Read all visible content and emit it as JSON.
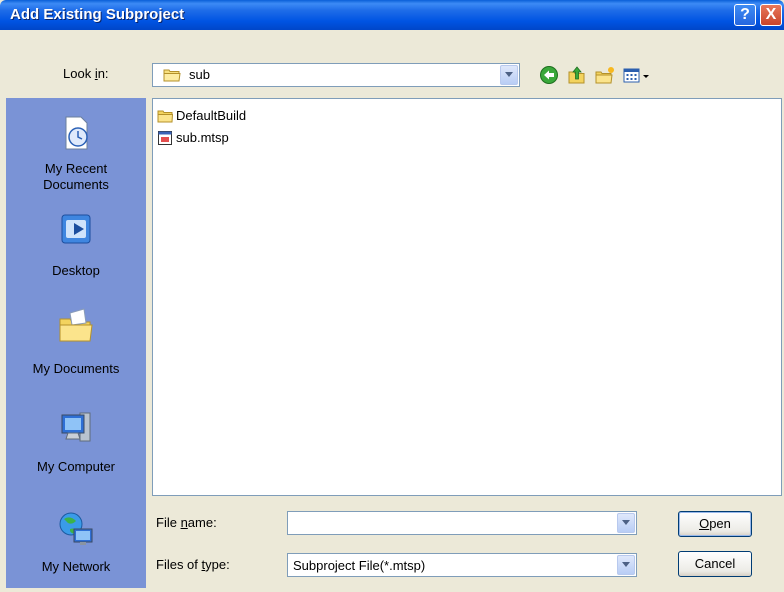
{
  "window": {
    "title": "Add Existing Subproject",
    "help_glyph": "?",
    "close_glyph": "X"
  },
  "lookin": {
    "label_pre": "Look ",
    "label_key": "i",
    "label_post": "n:",
    "value": "sub"
  },
  "toolbar": {
    "icons": [
      "back-icon",
      "up-folder-icon",
      "new-folder-icon",
      "view-menu-icon"
    ]
  },
  "places": [
    {
      "label_line1": "My Recent",
      "label_line2": "Documents",
      "icon": "recent-documents-icon"
    },
    {
      "label_line1": "Desktop",
      "label_line2": "",
      "icon": "desktop-icon"
    },
    {
      "label_line1": "My Documents",
      "label_line2": "",
      "icon": "my-documents-icon"
    },
    {
      "label_line1": "My Computer",
      "label_line2": "",
      "icon": "my-computer-icon"
    },
    {
      "label_line1": "My Network",
      "label_line2": "",
      "icon": "my-network-icon"
    }
  ],
  "files": [
    {
      "name": "DefaultBuild",
      "icon": "folder-icon"
    },
    {
      "name": "sub.mtsp",
      "icon": "mtsp-file-icon"
    }
  ],
  "filename": {
    "label_pre": "File ",
    "label_key": "n",
    "label_post": "ame:",
    "value": ""
  },
  "filetype": {
    "label_pre": "Files of ",
    "label_key": "t",
    "label_post": "ype:",
    "value": "Subproject File(*.mtsp)"
  },
  "buttons": {
    "open_key": "O",
    "open_rest": "pen",
    "cancel": "Cancel"
  },
  "colors": {
    "titlebar": "#0054e3",
    "face": "#ece9d8",
    "places_bar": "#7a93d6"
  }
}
